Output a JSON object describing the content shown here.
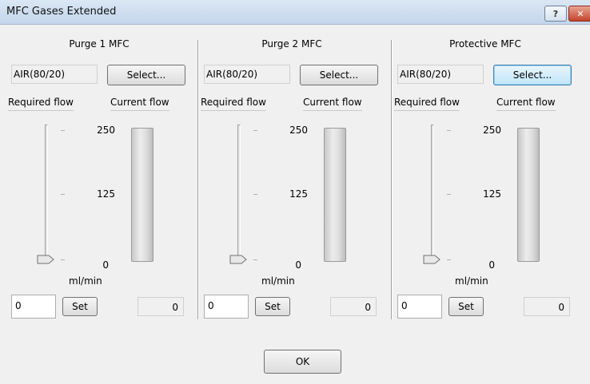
{
  "window": {
    "title": "MFC Gases Extended",
    "help_icon": "question-mark-icon",
    "close_icon": "close-x-icon"
  },
  "panels": [
    {
      "title": "Purge 1 MFC",
      "gas": "AIR(80/20)",
      "select_label": "Select...",
      "required_flow_label": "Required flow",
      "current_flow_label": "Current flow",
      "scale_max": "250",
      "scale_mid": "125",
      "scale_min": "0",
      "unit": "ml/min",
      "setpoint": "0",
      "set_label": "Set",
      "current_value": "0",
      "slider_level": 0,
      "flow_level": 0
    },
    {
      "title": "Purge 2 MFC",
      "gas": "AIR(80/20)",
      "select_label": "Select...",
      "required_flow_label": "Required flow",
      "current_flow_label": "Current flow",
      "scale_max": "250",
      "scale_mid": "125",
      "scale_min": "0",
      "unit": "ml/min",
      "setpoint": "0",
      "set_label": "Set",
      "current_value": "0",
      "slider_level": 0,
      "flow_level": 0
    },
    {
      "title": "Protective MFC",
      "gas": "AIR(80/20)",
      "select_label": "Select...",
      "required_flow_label": "Required flow",
      "current_flow_label": "Current flow",
      "scale_max": "250",
      "scale_mid": "125",
      "scale_min": "0",
      "unit": "ml/min",
      "setpoint": "0",
      "set_label": "Set",
      "current_value": "0",
      "slider_level": 0,
      "flow_level": 0
    }
  ],
  "footer": {
    "ok_label": "OK"
  }
}
